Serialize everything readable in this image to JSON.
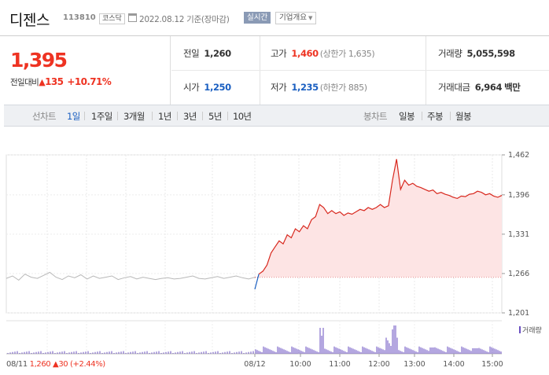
{
  "header": {
    "name": "디젠스",
    "code": "113810",
    "market": "코스닥",
    "date": "2022.08.12  기준(장마감)",
    "realtime_label": "실시간",
    "overview_label": "기업개요"
  },
  "price": {
    "current": "1,395",
    "change_label": "전일대비",
    "change_arrow": "▲",
    "change_amount": "135",
    "change_pct": "+10.71%"
  },
  "info": {
    "prev_close_label": "전일",
    "prev_close": "1,260",
    "high_label": "고가",
    "high": "1,460",
    "upper_limit": "(상한가 1,635)",
    "volume_label": "거래량",
    "volume": "5,055,598",
    "open_label": "시가",
    "open": "1,250",
    "low_label": "저가",
    "low": "1,235",
    "lower_limit": "(하한가 885)",
    "turnover_label": "거래대금",
    "turnover": "6,964",
    "turnover_unit": "백만"
  },
  "tabs": {
    "line_label": "선차트",
    "periods": [
      "1일",
      "1주일",
      "3개월",
      "1년",
      "3년",
      "5년",
      "10년"
    ],
    "active_period": "1일",
    "candle_label": "봉차트",
    "candles": [
      "일봉",
      "주봉",
      "월봉"
    ]
  },
  "chart_data": {
    "type": "line",
    "y_ticks": [
      "1,462",
      "1,396",
      "1,331",
      "1,266",
      "1,201"
    ],
    "ylim": [
      1201,
      1462
    ],
    "x_ticks": [
      "08/11",
      "08/12",
      "10:00",
      "11:00",
      "12:00",
      "13:00",
      "14:00",
      "15:00"
    ],
    "reference_price": 1260,
    "prev_day_series": [
      1258,
      1262,
      1255,
      1265,
      1260,
      1258,
      1263,
      1268,
      1260,
      1256,
      1262,
      1259,
      1264,
      1257,
      1262,
      1258,
      1260,
      1262,
      1256,
      1259,
      1261,
      1257,
      1260,
      1258,
      1256,
      1258,
      1259,
      1257,
      1258,
      1260,
      1262,
      1258,
      1257,
      1259,
      1261,
      1258,
      1260,
      1262,
      1259,
      1257,
      1260
    ],
    "today_series": [
      1240,
      1265,
      1270,
      1280,
      1300,
      1310,
      1320,
      1315,
      1330,
      1325,
      1340,
      1335,
      1345,
      1340,
      1355,
      1360,
      1380,
      1375,
      1365,
      1370,
      1365,
      1368,
      1362,
      1366,
      1364,
      1368,
      1372,
      1370,
      1375,
      1372,
      1375,
      1380,
      1375,
      1378,
      1420,
      1455,
      1405,
      1420,
      1412,
      1415,
      1410,
      1408,
      1405,
      1402,
      1404,
      1398,
      1400,
      1397,
      1395,
      1392,
      1390,
      1394,
      1393,
      1397,
      1398,
      1402,
      1400,
      1396,
      1398,
      1394,
      1392,
      1395
    ],
    "volume_legend": "거래량",
    "prev_day_summary": {
      "price": "1,260",
      "arrow": "▲",
      "change": "30",
      "pct": "(+2.44%)"
    }
  },
  "colors": {
    "up": "#ee3322",
    "down": "#1a5fc1",
    "line_up": "#d8281e",
    "fill_up": "#fde4e4",
    "prev_line": "#b8b8b8",
    "volume": "#6a4fc1"
  }
}
